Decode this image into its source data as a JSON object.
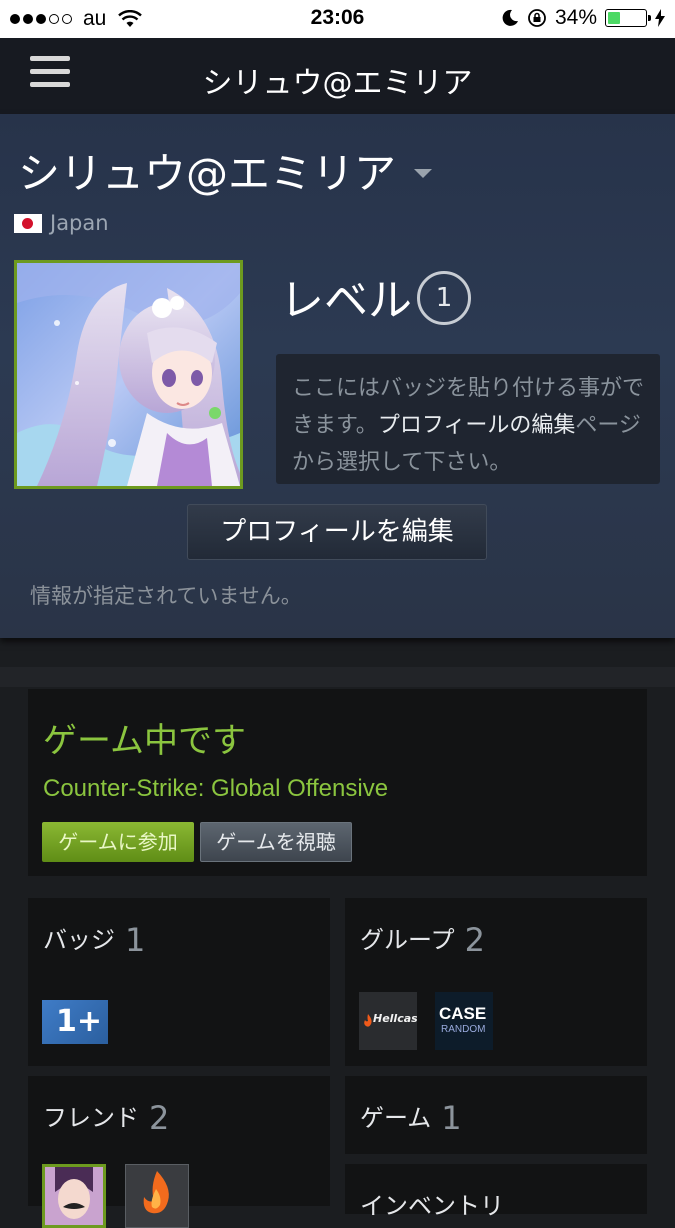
{
  "status_bar": {
    "carrier": "au",
    "time": "23:06",
    "battery": "34%",
    "battery_level": 0.34
  },
  "nav": {
    "title": "シリュウ@エミリア"
  },
  "profile": {
    "name": "シリュウ@エミリア",
    "country": "Japan",
    "level_label": "レベル",
    "level": "1",
    "badge_note_pre": "ここにはバッジを貼り付ける事ができます。",
    "badge_note_link": "プロフィールの編集",
    "badge_note_post": "ページから選択して下さい。",
    "edit_button": "プロフィールを編集",
    "no_info": "情報が指定されていません。"
  },
  "now_playing": {
    "title": "ゲーム中です",
    "game": "Counter-Strike: Global Offensive",
    "join_button": "ゲームに参加",
    "watch_button": "ゲームを視聴"
  },
  "badges": {
    "label": "バッジ",
    "count": "1",
    "badge_text": "1+"
  },
  "groups": {
    "label": "グループ",
    "count": "2",
    "items": [
      "Hellcase",
      "CASE",
      "RANDOM"
    ]
  },
  "friends": {
    "label": "フレンド",
    "count": "2"
  },
  "games": {
    "label": "ゲーム",
    "count": "1"
  },
  "inventory": {
    "label": "インベントリ"
  }
}
